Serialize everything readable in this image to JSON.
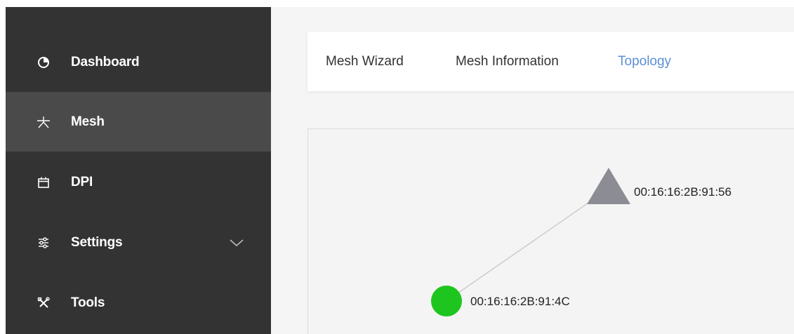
{
  "sidebar": {
    "items": [
      {
        "label": "Dashboard",
        "icon": "pie-chart-icon"
      },
      {
        "label": "Mesh",
        "icon": "mesh-icon"
      },
      {
        "label": "DPI",
        "icon": "calendar-icon"
      },
      {
        "label": "Settings",
        "icon": "sliders-icon",
        "expandable": true
      },
      {
        "label": "Tools",
        "icon": "tools-icon"
      }
    ],
    "active_index": 1
  },
  "tabs": [
    {
      "label": "Mesh Wizard"
    },
    {
      "label": "Mesh Information"
    },
    {
      "label": "Topology"
    }
  ],
  "active_tab": 2,
  "topology": {
    "nodes": [
      {
        "label": "00:16:16:2B:91:56",
        "shape": "triangle",
        "color": "#8c8c94"
      },
      {
        "label": "00:16:16:2B:91:4C",
        "shape": "circle",
        "color": "#1ec51e"
      }
    ],
    "link_color": "#cccccc"
  },
  "colors": {
    "sidebar_bg": "#333333",
    "sidebar_active_bg": "#4a4a4a",
    "accent": "#5b8fd6"
  }
}
